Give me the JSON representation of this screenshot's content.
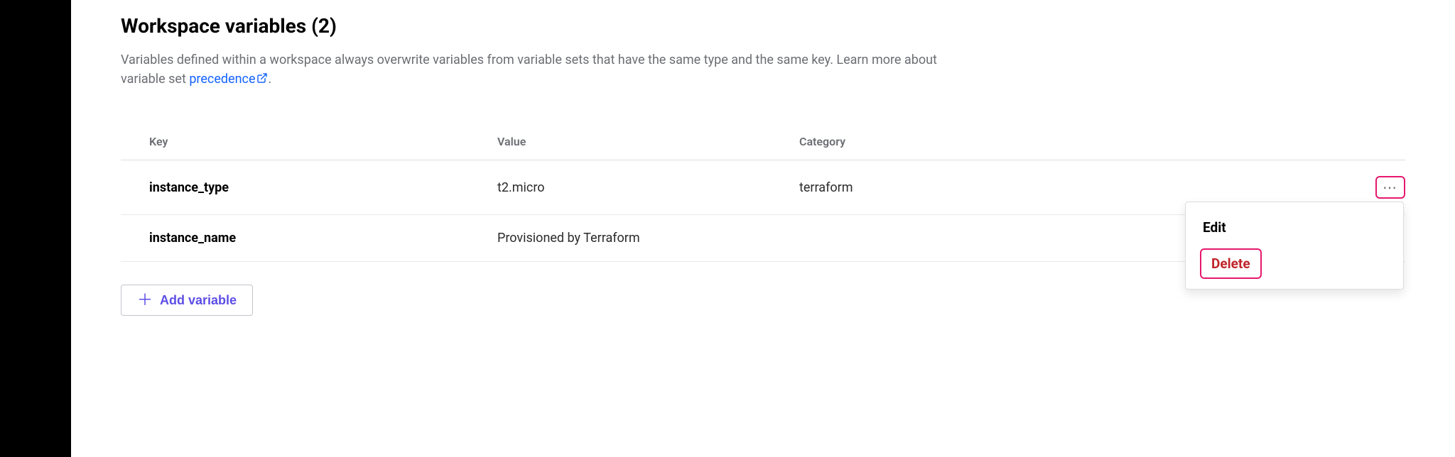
{
  "title": "Workspace variables (2)",
  "description_prefix": "Variables defined within a workspace always overwrite variables from variable sets that have the same type and the same key. Learn more about variable set ",
  "description_link_text": "precedence",
  "description_suffix": ".",
  "table": {
    "headers": {
      "key": "Key",
      "value": "Value",
      "category": "Category"
    },
    "rows": [
      {
        "key": "instance_type",
        "value": "t2.micro",
        "category": "terraform"
      },
      {
        "key": "instance_name",
        "value": "Provisioned by Terraform",
        "category": ""
      }
    ]
  },
  "dropdown": {
    "edit": "Edit",
    "delete": "Delete"
  },
  "add_button": "Add variable"
}
